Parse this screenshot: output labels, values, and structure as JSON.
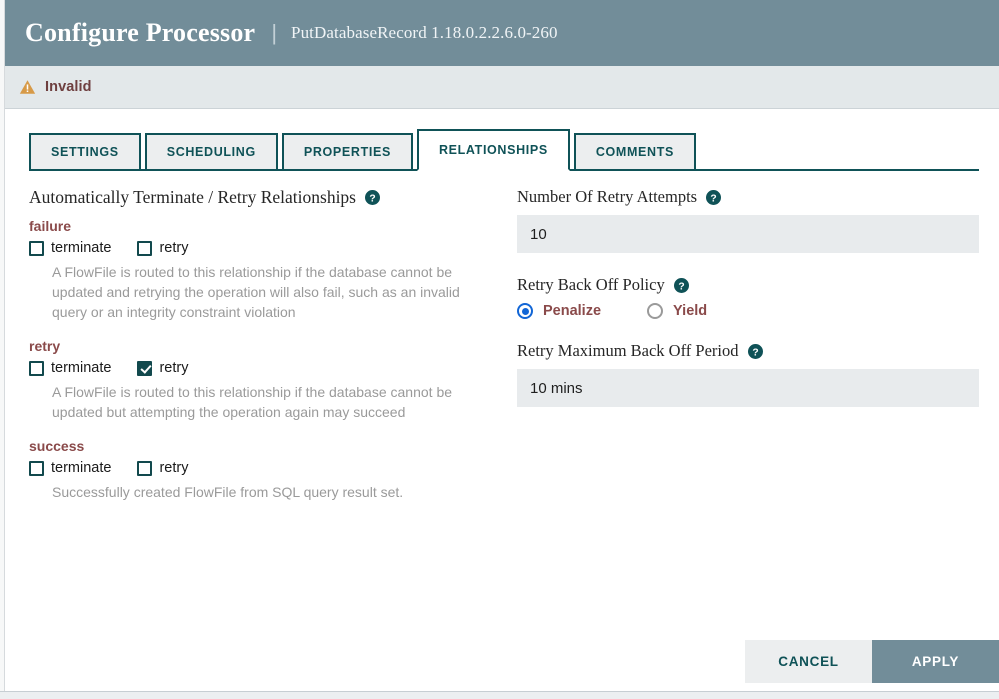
{
  "header": {
    "title": "Configure Processor",
    "separator": "|",
    "subtitle": "PutDatabaseRecord 1.18.0.2.2.6.0-260",
    "bg_color": "#728d99"
  },
  "status": {
    "label": "Invalid",
    "icon": "warning-triangle-icon",
    "text_color": "#6e3f3f",
    "icon_color": "#d79a48"
  },
  "tabs": [
    {
      "label": "SETTINGS",
      "active": false
    },
    {
      "label": "SCHEDULING",
      "active": false
    },
    {
      "label": "PROPERTIES",
      "active": false
    },
    {
      "label": "RELATIONSHIPS",
      "active": true
    },
    {
      "label": "COMMENTS",
      "active": false
    }
  ],
  "tab_accent_color": "#0f5257",
  "relationships_panel": {
    "heading": "Automatically Terminate / Retry Relationships",
    "heading_help_icon": "help-circle-icon",
    "checkbox_terminate_label": "terminate",
    "checkbox_retry_label": "retry",
    "items": [
      {
        "name": "failure",
        "terminate_checked": false,
        "retry_checked": false,
        "description": "A FlowFile is routed to this relationship if the database cannot be updated and retrying the operation will also fail, such as an invalid query or an integrity constraint violation"
      },
      {
        "name": "retry",
        "terminate_checked": false,
        "retry_checked": true,
        "description": "A FlowFile is routed to this relationship if the database cannot be updated but attempting the operation again may succeed"
      },
      {
        "name": "success",
        "terminate_checked": false,
        "retry_checked": false,
        "description": "Successfully created FlowFile from SQL query result set."
      }
    ]
  },
  "retry_settings": {
    "number_of_retry_attempts": {
      "label": "Number Of Retry Attempts",
      "help_icon": "help-circle-icon",
      "value": "10"
    },
    "retry_back_off_policy": {
      "label": "Retry Back Off Policy",
      "help_icon": "help-circle-icon",
      "options": [
        {
          "label": "Penalize",
          "selected": true
        },
        {
          "label": "Yield",
          "selected": false
        }
      ]
    },
    "retry_maximum_back_off_period": {
      "label": "Retry Maximum Back Off Period",
      "help_icon": "help-circle-icon",
      "value": "10 mins"
    }
  },
  "footer": {
    "cancel_label": "CANCEL",
    "apply_label": "APPLY"
  }
}
